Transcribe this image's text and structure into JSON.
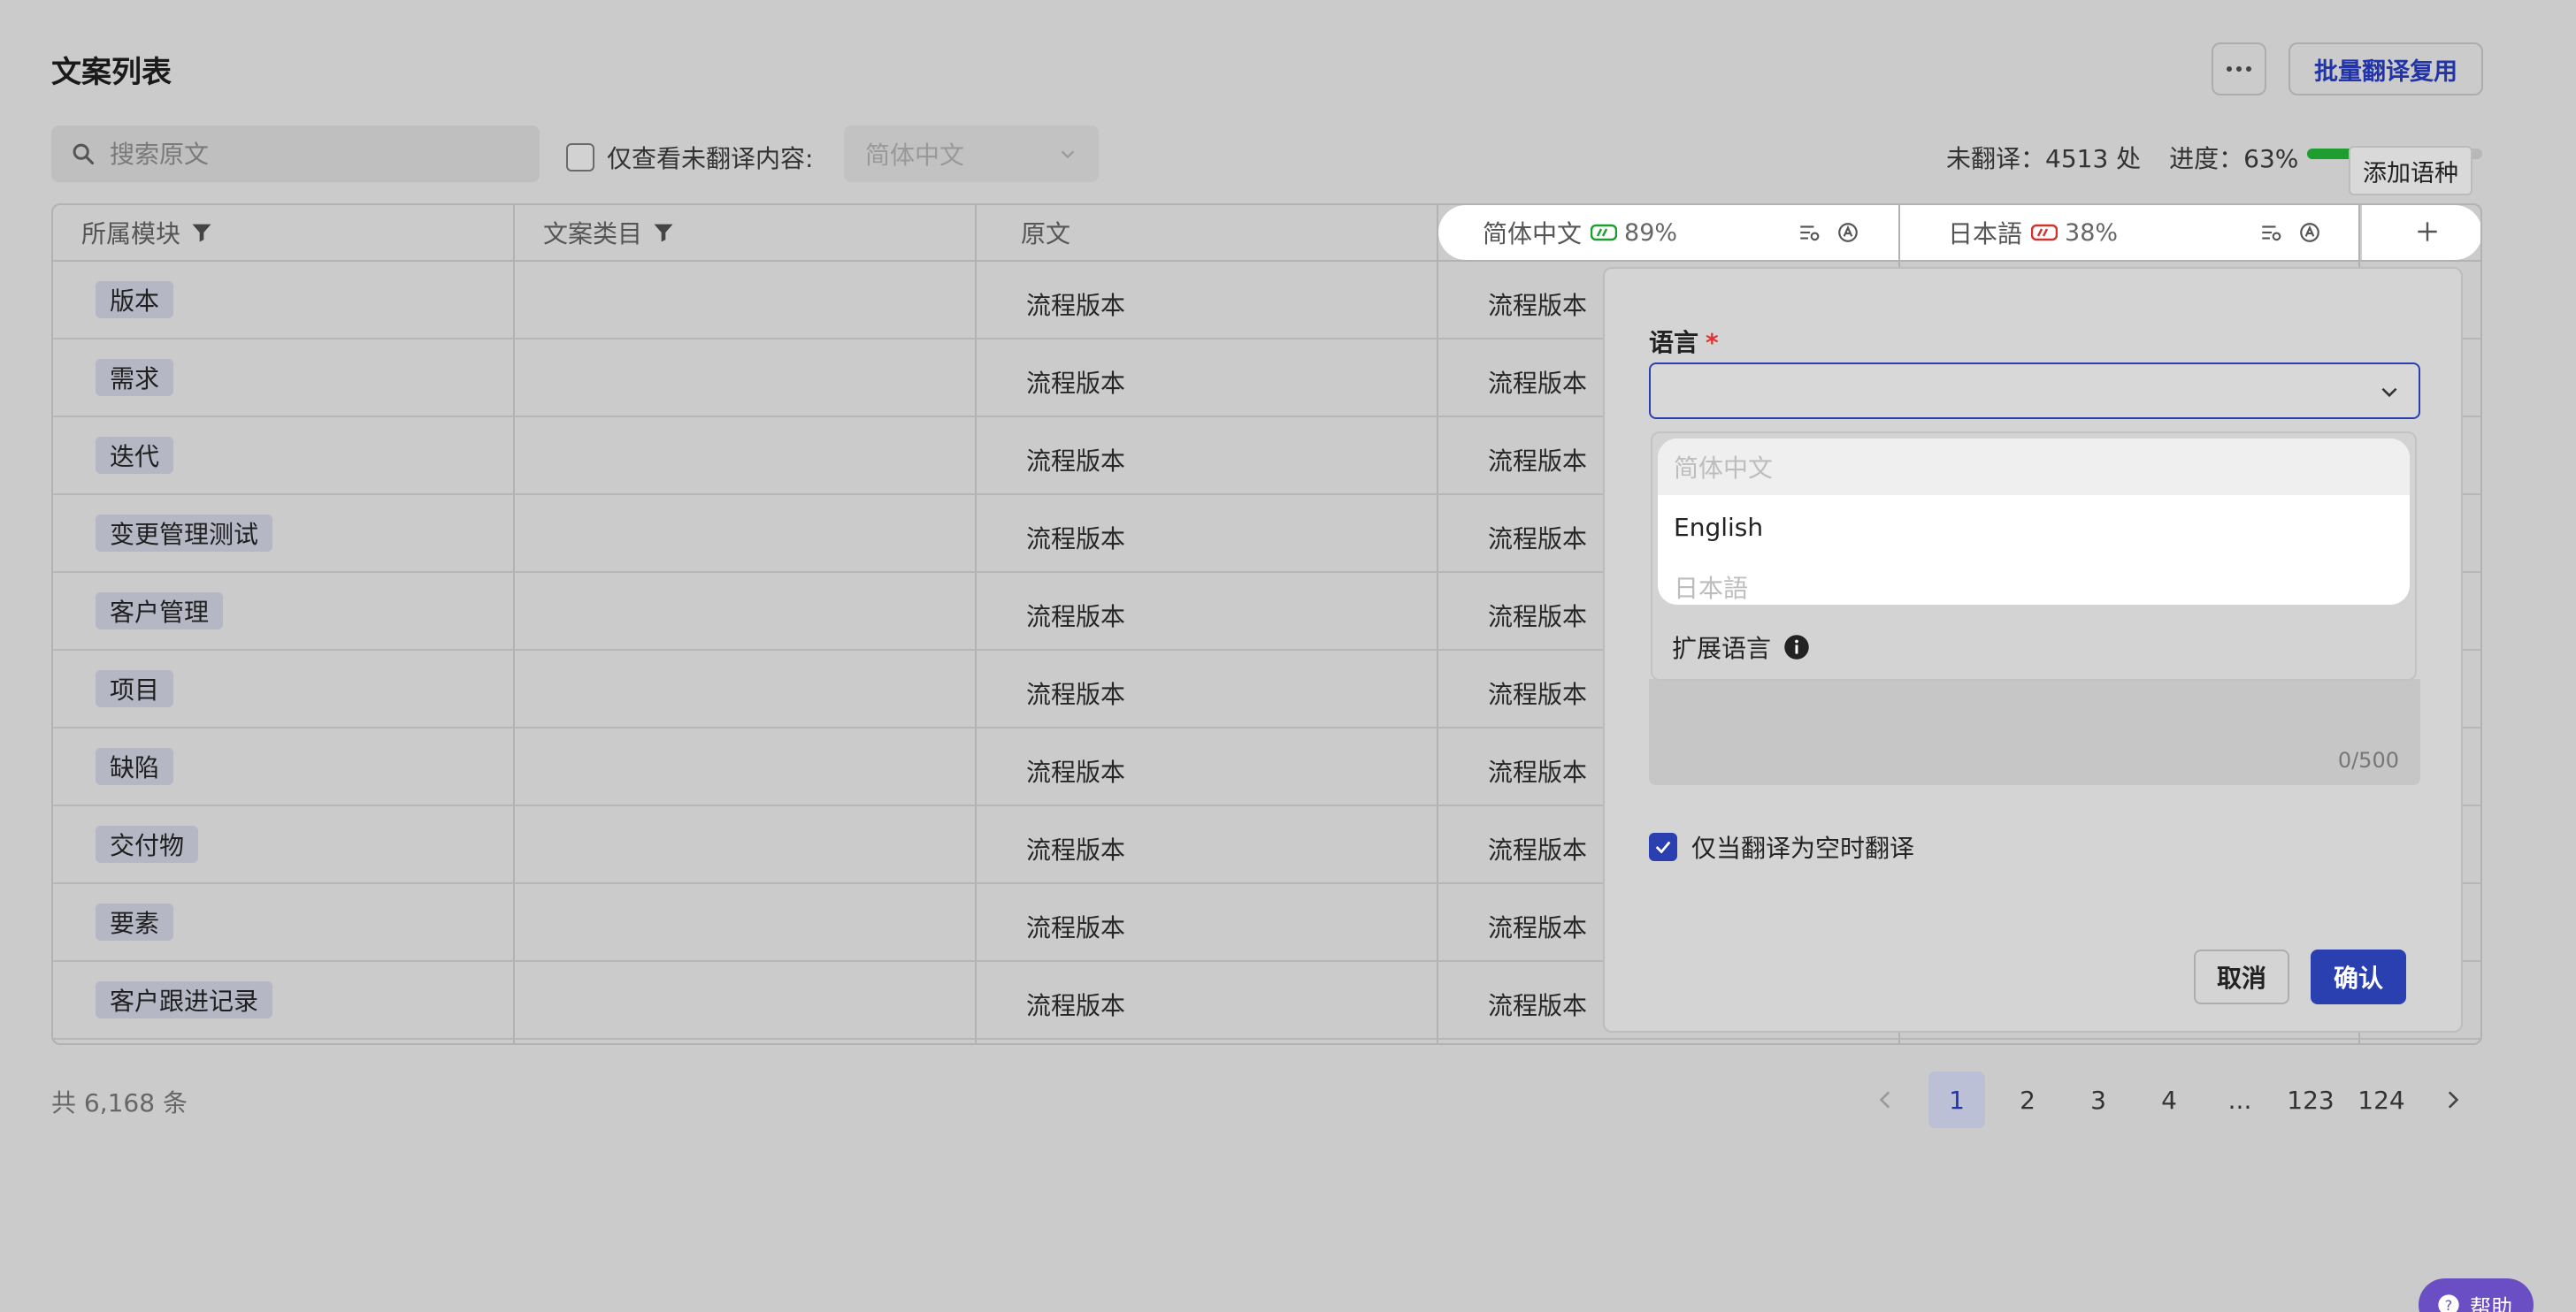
{
  "header": {
    "title": "文案列表",
    "more_label": "···",
    "batch_label": "批量翻译复用"
  },
  "toolbar": {
    "search_placeholder": "搜索原文",
    "only_untranslated_label": "仅查看未翻译内容:",
    "language_select_value": "简体中文",
    "untranslated_text": "未翻译：4513 处",
    "progress_text": "进度：63%",
    "progress_value": 0.63,
    "tooltip": "添加语种"
  },
  "table": {
    "columns": {
      "module": "所属模块",
      "category": "文案类目",
      "source": "原文",
      "lang1": "简体中文",
      "lang1_pct": "89%",
      "lang2": "日本語",
      "lang2_pct": "38%",
      "add": "+"
    },
    "rows": [
      {
        "module": "版本",
        "source": "流程版本",
        "lang1": "流程版本"
      },
      {
        "module": "需求",
        "source": "流程版本",
        "lang1": "流程版本"
      },
      {
        "module": "迭代",
        "source": "流程版本",
        "lang1": "流程版本"
      },
      {
        "module": "变更管理测试",
        "source": "流程版本",
        "lang1": "流程版本"
      },
      {
        "module": "客户管理",
        "source": "流程版本",
        "lang1": "流程版本"
      },
      {
        "module": "项目",
        "source": "流程版本",
        "lang1": "流程版本"
      },
      {
        "module": "缺陷",
        "source": "流程版本",
        "lang1": "流程版本"
      },
      {
        "module": "交付物",
        "source": "流程版本",
        "lang1": "流程版本"
      },
      {
        "module": "要素",
        "source": "流程版本",
        "lang1": "流程版本"
      },
      {
        "module": "客户跟进记录",
        "source": "流程版本",
        "lang1": "流程版本"
      }
    ]
  },
  "pagination": {
    "total": "共 6,168 条",
    "pages": [
      "1",
      "2",
      "3",
      "4",
      "...",
      "123",
      "124"
    ]
  },
  "popup": {
    "language_label": "语言",
    "required_mark": "*",
    "options": [
      "简体中文",
      "English",
      "日本語"
    ],
    "extension_label": "扩展语言",
    "counter": "0/500",
    "only_empty_label": "仅当翻译为空时翻译",
    "cancel_label": "取消",
    "confirm_label": "确认"
  },
  "help_label": "帮助",
  "colors": {
    "primary": "#2a3fb0",
    "progress": "#1e9e2f",
    "lang1_badge": "#1e9e2f",
    "lang2_badge": "#d0342c"
  }
}
